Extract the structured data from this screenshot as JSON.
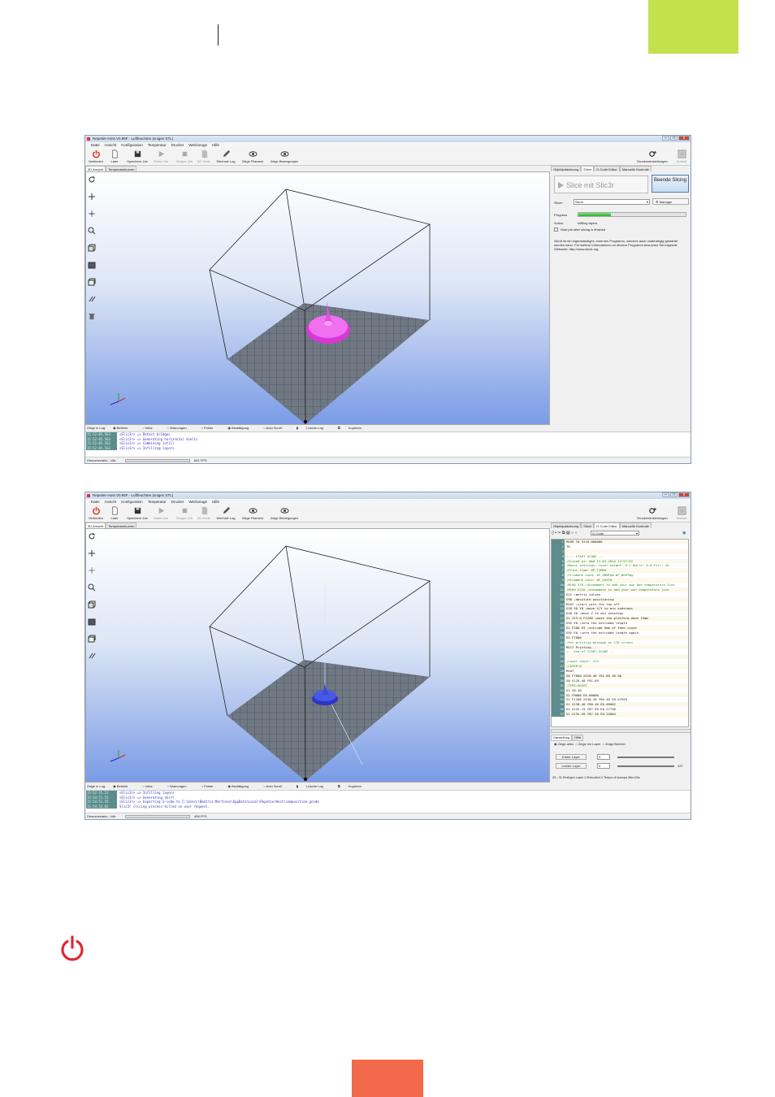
{
  "app": {
    "title": "Repetier-Host V0.95F - Luftfeuchten (snigen STL)",
    "window_controls": [
      "–",
      "□",
      "x"
    ],
    "menu": [
      "Datei",
      "Ansicht",
      "Konfiguration",
      "Temperatur",
      "Drucker",
      "Werkzeuge",
      "Hilfe"
    ],
    "toolbar": [
      {
        "label": "Verbinden",
        "icon": "power-icon"
      },
      {
        "label": "Lade",
        "icon": "file-icon"
      },
      {
        "label": "Speichere Job",
        "icon": "save-icon"
      },
      {
        "label": "Starte Job",
        "icon": "play-icon"
      },
      {
        "label": "Stoppe Job",
        "icon": "stop-icon"
      },
      {
        "label": "SD-Karte",
        "icon": "sd-card-icon"
      },
      {
        "label": "Wechsle Log",
        "icon": "pencil-icon"
      },
      {
        "label": "Zeige Filament",
        "icon": "eye-icon"
      },
      {
        "label": "Zeige Bewegungen",
        "icon": "eye-icon"
      }
    ],
    "toolbar_right": [
      {
        "label": "Druckereinstellungen",
        "icon": "gears-icon"
      },
      {
        "label": "Nothalt",
        "icon": "emergency-stop-icon"
      }
    ],
    "left_tabs": [
      "3D Ansicht",
      "Temperaturkurven"
    ],
    "right_tabs": [
      "Objektplatzierung",
      "Slicer",
      "G-Code Editor",
      "Manuelle Kontrolle"
    ],
    "log_options": [
      "Zeige in Log:",
      "Befehle",
      "Infos",
      "Warnungen",
      "Fehler",
      "Bestätigung",
      "Auto Scroll",
      "Lösche Log",
      "Kopieren"
    ]
  },
  "screenshot1": {
    "active_right_tab": "Slicer",
    "slice_button": "Slice mit Slic3r",
    "end_button": "Beende Slicing",
    "slicer_label": "Slicer:",
    "slicer_value": "Slic3r",
    "manager_button": "Manager",
    "progress_label": "Progress",
    "progress_fraction": 0.3,
    "action_label": "Action:",
    "action_value": "Infilling layers",
    "checkbox_label": "Start job after slicing is finished",
    "description": "Slic3r ist ein eigenständiges, externes Programm, welches auch unabhängig gestartet werden kann. Für weitere Informationen zu diesem Programm besuchen Sie folgende Webseite: http://www.slic3r.org",
    "log": [
      {
        "ts": "15:52:05.563",
        "msg": "<Slic3r> => Detect bridges"
      },
      {
        "ts": "15:52:05.563",
        "msg": "<Slic3r> => Generating horizontal shells"
      },
      {
        "ts": "15:52:05.563",
        "msg": "<Slic3r> => Combining infill"
      },
      {
        "ts": "15:52:05.563",
        "msg": "<Slic3r> => Infilling layers"
      }
    ],
    "status": {
      "connection": "Desconectado",
      "state": "Idle",
      "fps": "661 FPS"
    },
    "model_color": "#e040e0"
  },
  "screenshot2": {
    "active_right_tab": "G-Code Editor",
    "gcode_select": "G-Code",
    "gcode_lines": [
      "M109 T0 S210.000000",
      "T0",
      "",
      ";--- START GCODE ---",
      ";Sliced at: Wed 12-03-2014 12:57:52",
      ";Basic settings: Layer height: 0.2 Walls: 0.8 Fill: 20",
      ";Print time: #P_TIME#",
      ";Filament used: #F_AMNT#m #F_WGHT#g",
      ";Filament cost: #F_COST#",
      ";M190 S70 ;Uncomment to add your own bed temperature line",
      ";M109 S210 ;Uncomment to add your own temperature line",
      "G21        ;metric values",
      "G90        ;absolute positioning",
      "M107       ;start with the fan off",
      "G28 X0 Y0  ;move X/Y to min endstops",
      "G28 Z0     ;move Z to min endstops",
      "G1 Z15.0 F1200 ;move the platform down 15mm",
      "G92 E0                  ;zero the extruded length",
      "G1 F200 E5              ;extrude 5mm of feed stock",
      "G92 E0                  ;zero the extruded length again",
      "G1 F7800",
      ";Put printing message on LCD screen",
      "M117 Printing...",
      ";-- end of START GCODE --",
      "",
      ";Layer count: 224",
      ";LAYER:0",
      "M107",
      "G0 F7800 X120.40 Y91.69 Z0.30",
      "G0 X129.40 Y91.69",
      ";TYPE:SKIRT",
      "G1 Z0.30",
      "G1 F9000 E0.00000",
      "G1 F1200 X130.40 Y90.40 E0.07559",
      "G1 X130.40 Y90.40 E0.09002",
      "G1 X132.19 Y87.99 E0.27730",
      "G1 X132.99 Y87.50 E0.24964"
    ],
    "sub_tabs": [
      "Darstellung",
      "Hilfe"
    ],
    "radio_options": [
      "Zeige alles",
      "Zeige ein Layer",
      "Zeige Bereich"
    ],
    "first_layer_button": "Erster Layer",
    "last_layer_button": "Letzter Layer",
    "first_layer_value": "0",
    "last_layer_value": "0",
    "layer_max": "227",
    "editor_status": "Z5 : 31   Einfügen   Layer 0   Extrudiert 0   Tempo di stampa 38m:53s",
    "log": [
      {
        "ts": "15:52:15.52",
        "msg": "<Slic3r> => Infilling layers"
      },
      {
        "ts": "15:54:51.55",
        "msg": "<Slic3r> => Generating skirt"
      },
      {
        "ts": "15:54:51.55",
        "msg": "<Slic3r> => Exporting G-code to C:\\Users\\Beatriz-Martinez\\AppData\\Local\\RepetierHost\\composition.gcode"
      },
      {
        "ts": "15:54:52.02",
        "msg": "Slic3r slicing process killed on user request."
      }
    ],
    "status": {
      "connection": "Desconectado",
      "state": "Idle",
      "fps": "458 FPS"
    },
    "model_color": "#3a49d9"
  },
  "colors": {
    "green_block": "#c4e04a",
    "orange_block": "#f26a4b",
    "power_icon": "#e3262f"
  }
}
